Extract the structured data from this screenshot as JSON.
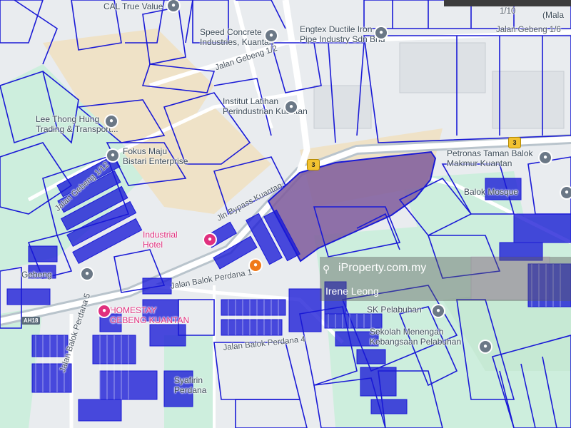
{
  "map": {
    "labels": {
      "cal_true_value": "CAL True Value",
      "speed_concrete": "Speed Concrete\nIndustries, Kuantan",
      "engtex": "Engtex Ductile Iron\nPipe Industry Sdn Bhd",
      "jalan_gebeng_1_6": "Jalan Gebeng 1/6",
      "jalan_gebeng_1_2": "Jalan Gebeng 1/2",
      "institut": "Institut Latihan\nPerindustrian Kuantan",
      "lee_thong_hung": "Lee Thong Hung\nTrading & Transport...",
      "fokus_maju": "Fokus Maju\nBistari Enterprise",
      "jalan_gebeng_1_12": "Jalan Gebeng 1/12",
      "jln_bypass": "Jln Bypass Kuantan",
      "petronas": "Petronas Taman Balok\nMakmur Kuantan",
      "balok_mosque": "Balok Mosque",
      "industrial_hotel": "Industrial\nHotel",
      "jalan_balok_perdana_1": "Jalan Balok Perdana 1",
      "jalan_balok_perdana_5": "Jalan Balok Perdana 5",
      "jalan_balok_perdana_4": "Jalan Balok Perdana 4",
      "homestay": "HOMESTAY\nGEBENG KUANTAN",
      "sk_pelabuhan": "SK Pelabuhan",
      "sekolah": "Sekolah Menengah\nKebangsaan Pelabuhan",
      "syafirin": "Syafirin\nPerdana",
      "gebeng_left": "Gebeng",
      "malay_corner": "(Mala",
      "jalan_1_10": "1/10"
    },
    "shields": {
      "route_3_a": "3",
      "route_3_b": "3",
      "ah18": "AH18"
    }
  },
  "watermark": {
    "site": "iProperty.com.my",
    "agent": "Irene Leong"
  },
  "colors": {
    "land": "#e9ecef",
    "green": "#cdeedd",
    "sand": "#efe2c7",
    "lot_outline": "#1a1ad6",
    "highlight": "#7e5a9b",
    "road": "#ffffff",
    "highway": "#b9c4cc"
  }
}
